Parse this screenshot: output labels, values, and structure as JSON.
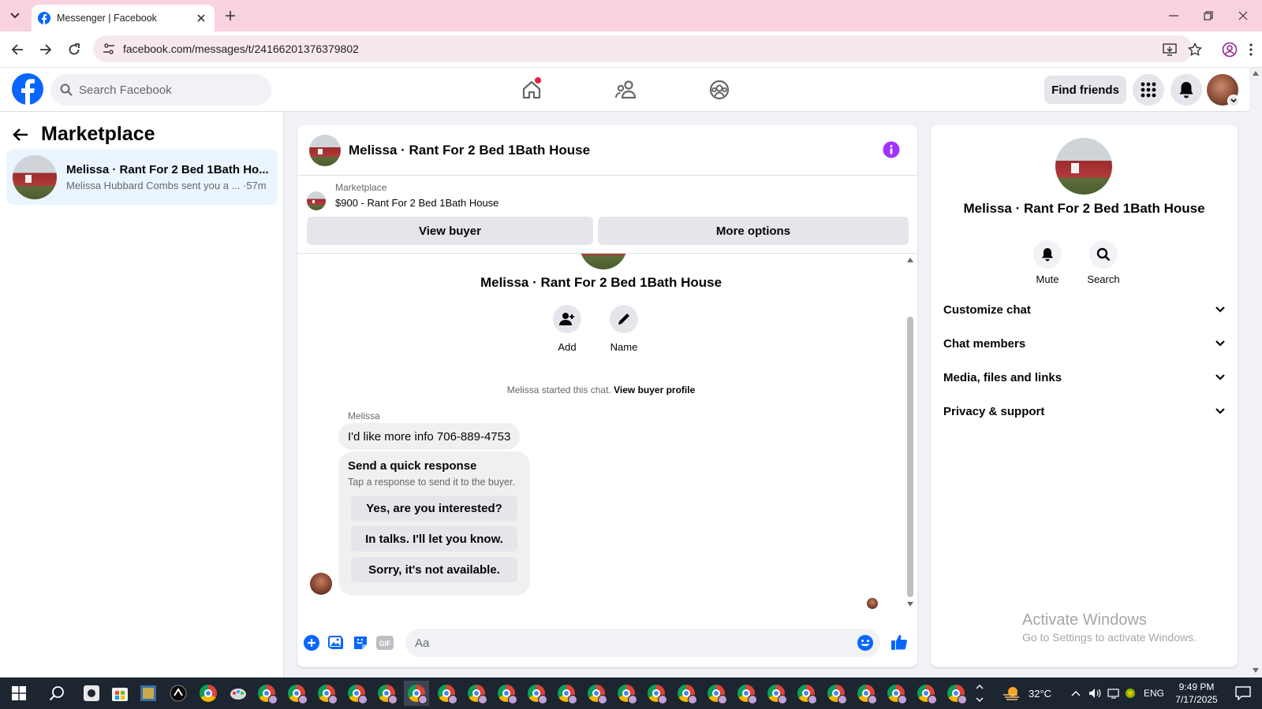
{
  "browser": {
    "tab_title": "Messenger | Facebook",
    "url": "facebook.com/messages/t/24166201376379802"
  },
  "fb_header": {
    "search_placeholder": "Search Facebook",
    "find_friends": "Find friends"
  },
  "left_panel": {
    "title": "Marketplace",
    "chat": {
      "name": "Melissa · Rant For 2 Bed 1Bath Ho...",
      "preview": "Melissa Hubbard Combs sent you a ... ·57m"
    }
  },
  "chat": {
    "header_name": "Melissa · Rant For 2 Bed 1Bath House",
    "marketplace_label": "Marketplace",
    "listing": "$900 - Rant For 2 Bed 1Bath House",
    "view_buyer": "View buyer",
    "more_options": "More options",
    "convo_title": "Melissa · Rant For 2 Bed 1Bath House",
    "add_label": "Add",
    "name_label": "Name",
    "started_text": "Melissa started this chat.",
    "started_link": "View buyer profile",
    "sender": "Melissa",
    "message": "I'd like more info 706-889-4753",
    "quick_title": "Send a quick response",
    "quick_sub": "Tap a response to send it to the buyer.",
    "quick_responses": [
      "Yes, are you interested?",
      "In talks. I'll let you know.",
      "Sorry, it's not available."
    ],
    "composer_placeholder": "Aa",
    "gif_label": "GIF"
  },
  "right_panel": {
    "name": "Melissa · Rant For 2 Bed 1Bath House",
    "mute": "Mute",
    "search": "Search",
    "sections": [
      "Customize chat",
      "Chat members",
      "Media, files and links",
      "Privacy & support"
    ]
  },
  "watermark": {
    "title": "Activate Windows",
    "sub": "Go to Settings to activate Windows."
  },
  "taskbar": {
    "temperature": "32°C",
    "language": "ENG",
    "time": "9:49 PM",
    "date": "7/17/2025"
  },
  "colors": {
    "fb_blue": "#0866ff",
    "accent_purple": "#a033ff",
    "tab_strip": "#f9d2e2"
  }
}
